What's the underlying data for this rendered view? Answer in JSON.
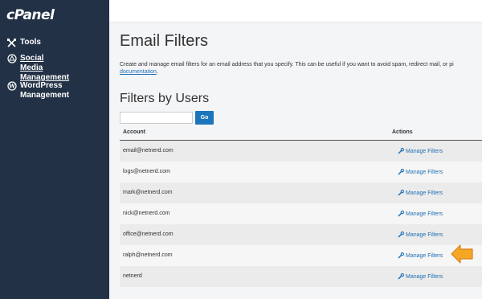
{
  "sidebar": {
    "logo": "cPanel",
    "items": [
      {
        "label": "Tools",
        "icon": "tools-icon"
      },
      {
        "label": "Social Media Management",
        "icon": "social-media-icon"
      },
      {
        "label": "WordPress Management",
        "icon": "wordpress-icon"
      }
    ]
  },
  "page": {
    "title": "Email Filters",
    "description": "Create and manage email filters for an email address that you specify. This can be useful if you want to avoid spam, redirect mail, or pi",
    "doc_link": "documentation",
    "doc_suffix": "."
  },
  "filters": {
    "section_title": "Filters by Users",
    "search_value": "",
    "go_label": "Go",
    "columns": {
      "account": "Account",
      "actions": "Actions"
    },
    "rows": [
      {
        "account": "email@netnerd.com",
        "action": "Manage Filters"
      },
      {
        "account": "logs@netnerd.com",
        "action": "Manage Filters"
      },
      {
        "account": "mark@netnerd.com",
        "action": "Manage Filters"
      },
      {
        "account": "nick@netnerd.com",
        "action": "Manage Filters"
      },
      {
        "account": "office@netnerd.com",
        "action": "Manage Filters"
      },
      {
        "account": "ralph@netnerd.com",
        "action": "Manage Filters"
      },
      {
        "account": "netnerd",
        "action": "Manage Filters"
      }
    ]
  },
  "colors": {
    "sidebar_bg": "#233146",
    "link": "#1f6fb5",
    "go_button": "#1b75bc",
    "highlight_arrow": "#f5a623"
  }
}
